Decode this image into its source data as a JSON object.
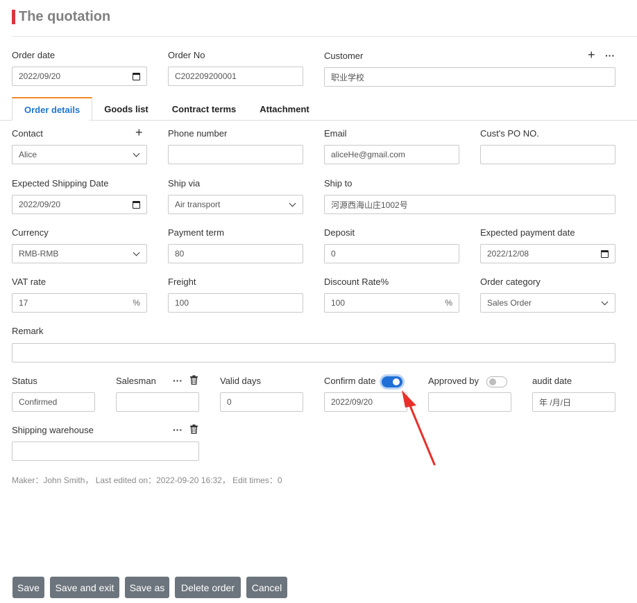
{
  "page": {
    "title": "The quotation"
  },
  "header_fields": {
    "order_date": {
      "label": "Order date",
      "value": "2022/09/20"
    },
    "order_no": {
      "label": "Order No",
      "value": "C202209200001"
    },
    "customer": {
      "label": "Customer",
      "value": "职业学校"
    }
  },
  "tabs": [
    {
      "label": "Order details",
      "active": true
    },
    {
      "label": "Goods list",
      "active": false
    },
    {
      "label": "Contract terms",
      "active": false
    },
    {
      "label": "Attachment",
      "active": false
    }
  ],
  "details": {
    "contact": {
      "label": "Contact",
      "value": "Alice"
    },
    "phone": {
      "label": "Phone number",
      "value": ""
    },
    "email": {
      "label": "Email",
      "value": "aliceHe@gmail.com"
    },
    "cust_po": {
      "label": "Cust's PO NO.",
      "value": ""
    },
    "expected_shipping": {
      "label": "Expected Shipping Date",
      "value": "2022/09/20"
    },
    "ship_via": {
      "label": "Ship via",
      "value": "Air transport"
    },
    "ship_to": {
      "label": "Ship to",
      "value": "河源西海山庄1002号"
    },
    "currency": {
      "label": "Currency",
      "value": "RMB-RMB"
    },
    "payment_term": {
      "label": "Payment term",
      "value": "80"
    },
    "deposit": {
      "label": "Deposit",
      "value": "0"
    },
    "expected_payment": {
      "label": "Expected payment date",
      "value": "2022/12/08"
    },
    "vat_rate": {
      "label": "VAT rate",
      "value": "17",
      "suffix": "%"
    },
    "freight": {
      "label": "Freight",
      "value": "100"
    },
    "discount_rate": {
      "label": "Discount Rate%",
      "value": "100",
      "suffix": "%"
    },
    "order_category": {
      "label": "Order category",
      "value": "Sales Order"
    },
    "remark": {
      "label": "Remark",
      "value": ""
    },
    "status": {
      "label": "Status",
      "value": "Confirmed"
    },
    "salesman": {
      "label": "Salesman",
      "value": ""
    },
    "valid_days": {
      "label": "Valid days",
      "value": "0"
    },
    "confirm_date": {
      "label": "Confirm date",
      "value": "2022/09/20",
      "toggle_on": true
    },
    "approved_by": {
      "label": "Approved by",
      "value": "",
      "toggle_on": false
    },
    "audit_date": {
      "label": "audit date",
      "placeholder": "年 /月/日"
    },
    "shipping_warehouse": {
      "label": "Shipping warehouse",
      "value": ""
    }
  },
  "meta": {
    "text": "Maker：John Smith，   Last edited on：2022-09-20 16:32，   Edit times：0"
  },
  "buttons": {
    "save": "Save",
    "save_exit": "Save and exit",
    "save_as": "Save as",
    "delete": "Delete order",
    "cancel": "Cancel"
  },
  "icons": {
    "plus": "+",
    "more": "···"
  },
  "colors": {
    "accent_red": "#d9363e",
    "tab_active_text": "#1f76d2",
    "tab_active_border": "#f08a24",
    "toggle_on": "#1f6fd6",
    "button_bg": "#6c757d",
    "annotation_arrow": "#e8302a"
  }
}
